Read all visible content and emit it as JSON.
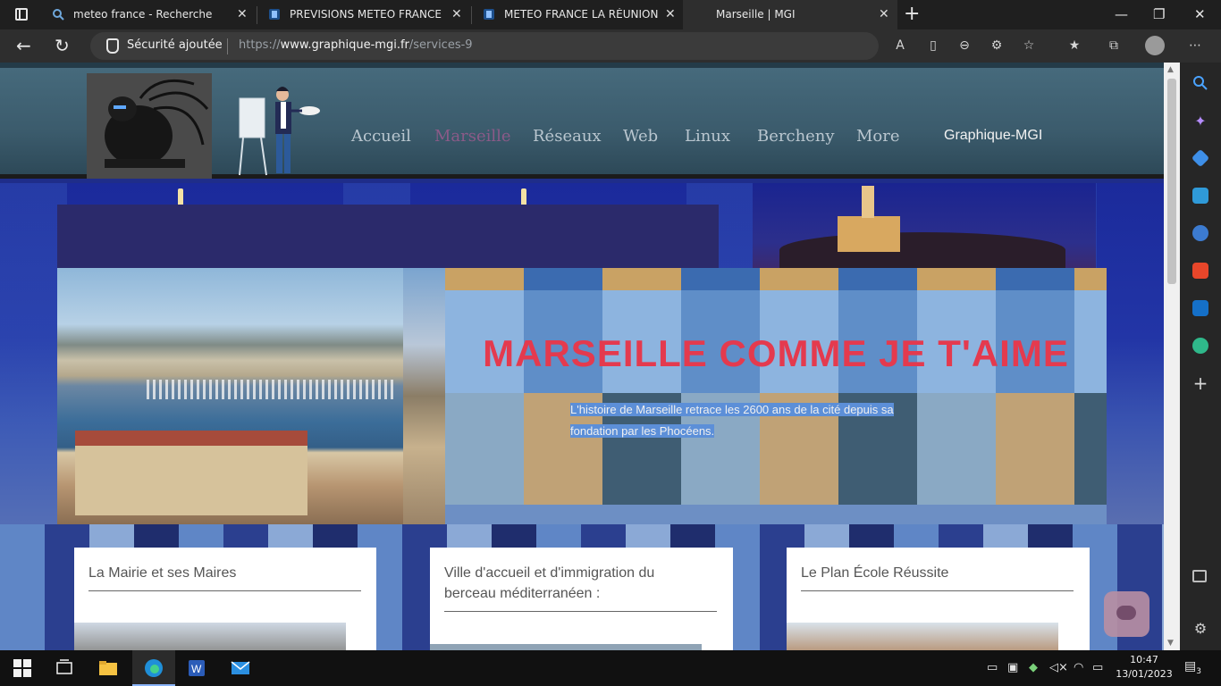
{
  "browser": {
    "tabs": [
      {
        "title": "meteo france - Recherche",
        "active": false
      },
      {
        "title": "PREVISIONS METEO FRANCE - Si",
        "active": false
      },
      {
        "title": "METEO FRANCE LA RÉUNION pa",
        "active": false
      },
      {
        "title": "Marseille | MGI",
        "active": true
      }
    ],
    "security_label": "Sécurité ajoutée",
    "url_prefix": "https://",
    "url_host": "www.graphique-mgi.fr",
    "url_path": "/services-9"
  },
  "site": {
    "nav": [
      {
        "label": "Accueil",
        "current": false
      },
      {
        "label": "Marseille",
        "current": true
      },
      {
        "label": "Réseaux",
        "current": false
      },
      {
        "label": "Web",
        "current": false
      },
      {
        "label": "Linux",
        "current": false
      },
      {
        "label": "Bercheny",
        "current": false
      },
      {
        "label": "More",
        "current": false
      }
    ],
    "brand": "Graphique-MGI",
    "hero_title": "MARSEILLE COMME JE T'AIME",
    "hero_text_line1": "L'histoire de Marseille retrace les 2600 ans de la cité depuis sa",
    "hero_text_line2": "fondation par les Phocéens.",
    "cards": [
      {
        "title": "La Mairie et ses Maires"
      },
      {
        "title_line1": "Ville d'accueil et d'immigration du",
        "title_line2": "berceau méditerranéen :"
      },
      {
        "title": "Le Plan École Réussite"
      }
    ]
  },
  "taskbar": {
    "time": "10:47",
    "date": "13/01/2023",
    "notifications": "3"
  },
  "colors": {
    "hero_title": "#e43a4e",
    "nav_current": "#8b5a88",
    "nav_text": "#b9c6cf",
    "header_bg": "#466a7c"
  }
}
